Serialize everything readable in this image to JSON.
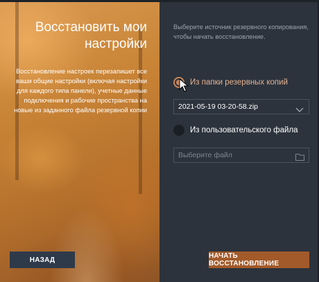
{
  "left": {
    "title": "Восстановить мои настройки",
    "description": "Восстановление настроек перезапишет все ваши общие настройки (включая настройки для каждого типа панели), учетные данные подключения и рабочие пространства на новые из заданного файла резервной копии",
    "back_label": "НАЗАД"
  },
  "right": {
    "subtitle": "Выберите источник резервного копирования, чтобы начать восстановление.",
    "option_backup_folder": "Из папки резервных копий",
    "selected_backup": "2021-05-19 03-20-58.zip",
    "option_custom_file": "Из пользовательского файла",
    "file_placeholder": "Выберите файл",
    "restore_label": "НАЧАТЬ ВОССТАНОВЛЕНИЕ"
  },
  "state": {
    "selected_option": "backup_folder"
  },
  "icons": {
    "dropdown": "chevron-down-icon",
    "folder": "folder-icon",
    "cursor": "mouse-cursor-icon"
  },
  "colors": {
    "accent": "#c8855a",
    "restore_button": "#a35a2a",
    "back_button": "#2e3a4a",
    "panel": "#2c333c"
  }
}
